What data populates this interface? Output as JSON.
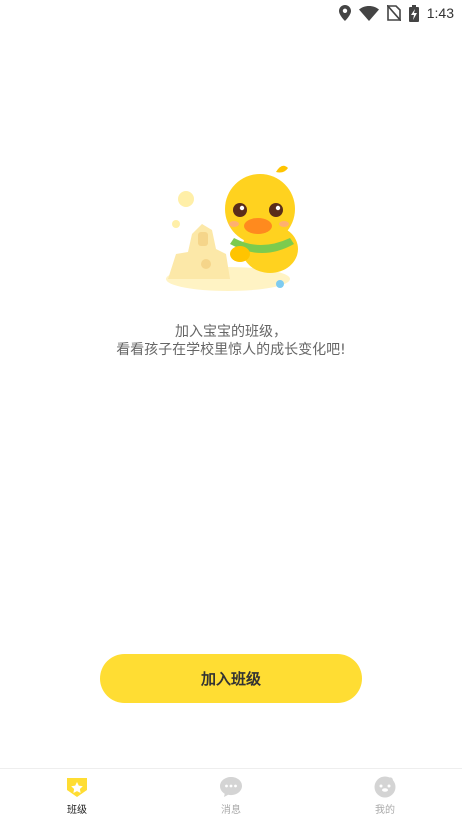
{
  "status_bar": {
    "time": "1:43",
    "icons": [
      "location-icon",
      "wifi-icon",
      "no-sim-icon",
      "battery-icon"
    ]
  },
  "empty_state": {
    "line1": "加入宝宝的班级，",
    "line2": "看看孩子在学校里惊人的成长变化吧!",
    "illustration": "duck-sandcastle"
  },
  "join_button": {
    "label": "加入班级"
  },
  "tabs": [
    {
      "label": "班级",
      "icon": "class-badge-icon",
      "active": true
    },
    {
      "label": "消息",
      "icon": "message-bubble-icon",
      "active": false
    },
    {
      "label": "我的",
      "icon": "profile-face-icon",
      "active": false
    }
  ],
  "colors": {
    "accent": "#FFDD33",
    "tab_inactive": "#CCCCCC",
    "text_muted": "#666666"
  }
}
